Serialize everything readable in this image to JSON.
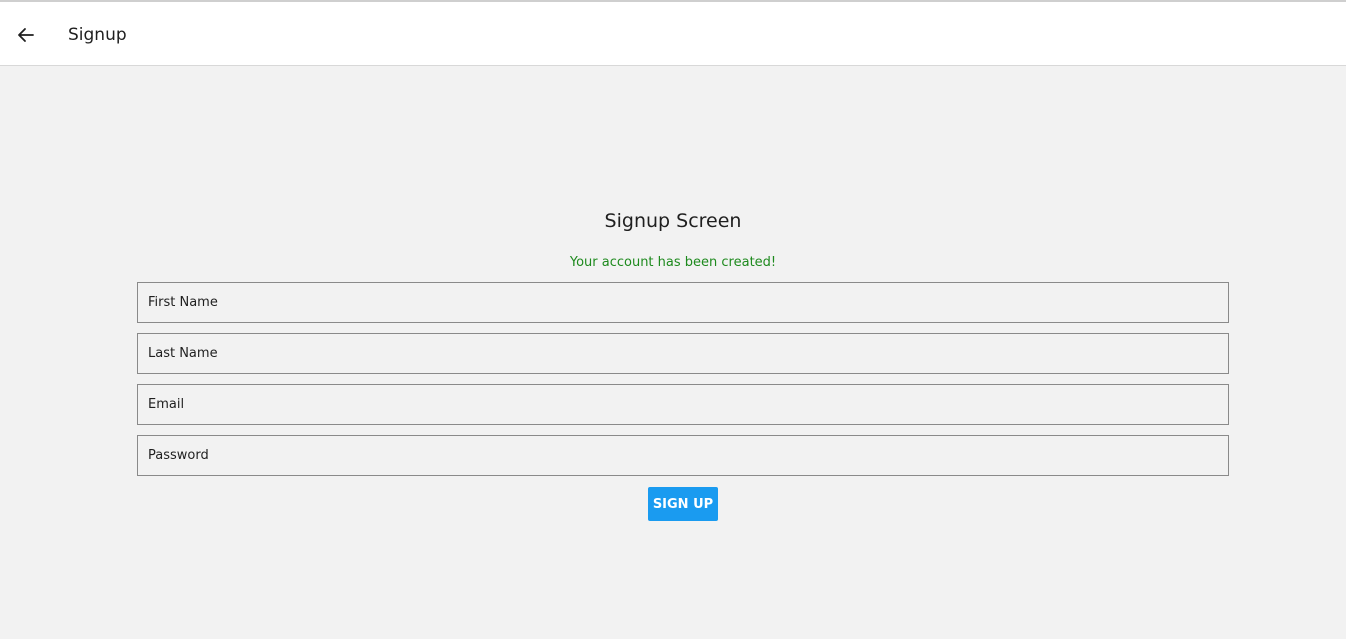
{
  "header": {
    "back_icon": "arrow-left-icon",
    "title": "Signup"
  },
  "form": {
    "title": "Signup Screen",
    "success_message": "Your account has been created!",
    "success_color": "#1e8a1e",
    "fields": [
      {
        "placeholder": "First Name",
        "value": ""
      },
      {
        "placeholder": "Last Name",
        "value": ""
      },
      {
        "placeholder": "Email",
        "value": ""
      },
      {
        "placeholder": "Password",
        "value": ""
      }
    ],
    "submit_label": "SIGN UP",
    "submit_color": "#1a9bf0"
  }
}
